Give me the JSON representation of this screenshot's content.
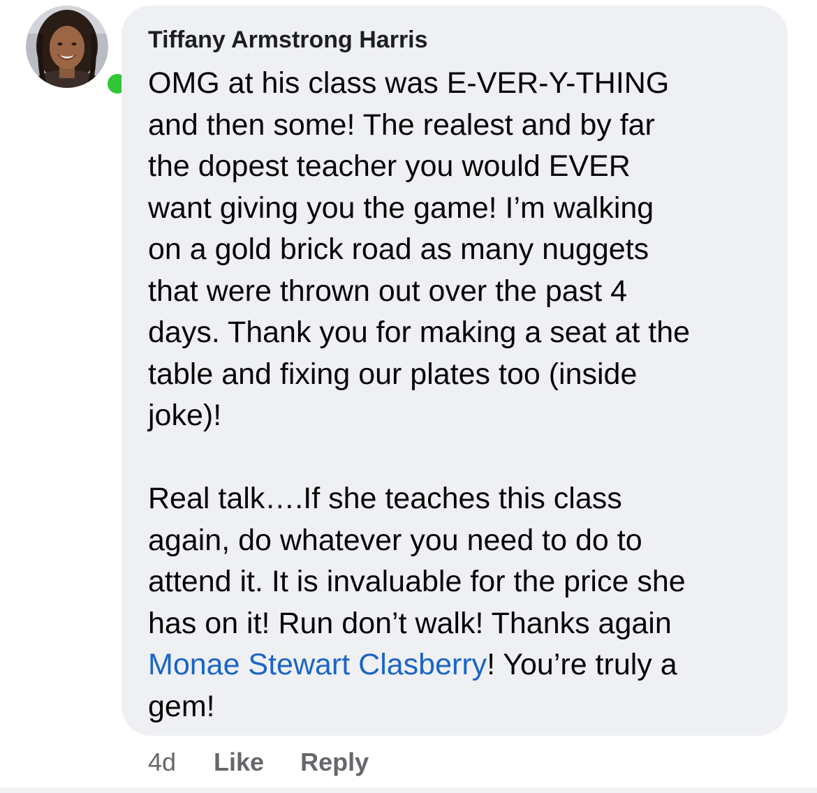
{
  "comment": {
    "author": "Tiffany Armstrong Harris",
    "avatar_icon": "profile-photo",
    "online_color": "#31c737",
    "paragraph_1": "OMG at his class was E-VER-Y-THING\nand then some!  The realest and by far\nthe dopest teacher you would EVER\nwant giving you the game! I’m walking\non a gold brick road as many nuggets\nthat were thrown out over the past 4\ndays. Thank you for making a seat at the\ntable and fixing our plates too (inside\njoke)!",
    "paragraph_2_lead": "Real talk….If she teaches this class\nagain, do whatever you need to do to\nattend it. It is invaluable for the price she\nhas on it!  Run don’t walk!  Thanks again\n",
    "mention": "Monae Stewart Clasberry",
    "paragraph_2_tail": "!  You’re truly a\ngem!",
    "mention_color": "#1a64c8"
  },
  "footer": {
    "time": "4d",
    "like_label": "Like",
    "reply_label": "Reply"
  }
}
